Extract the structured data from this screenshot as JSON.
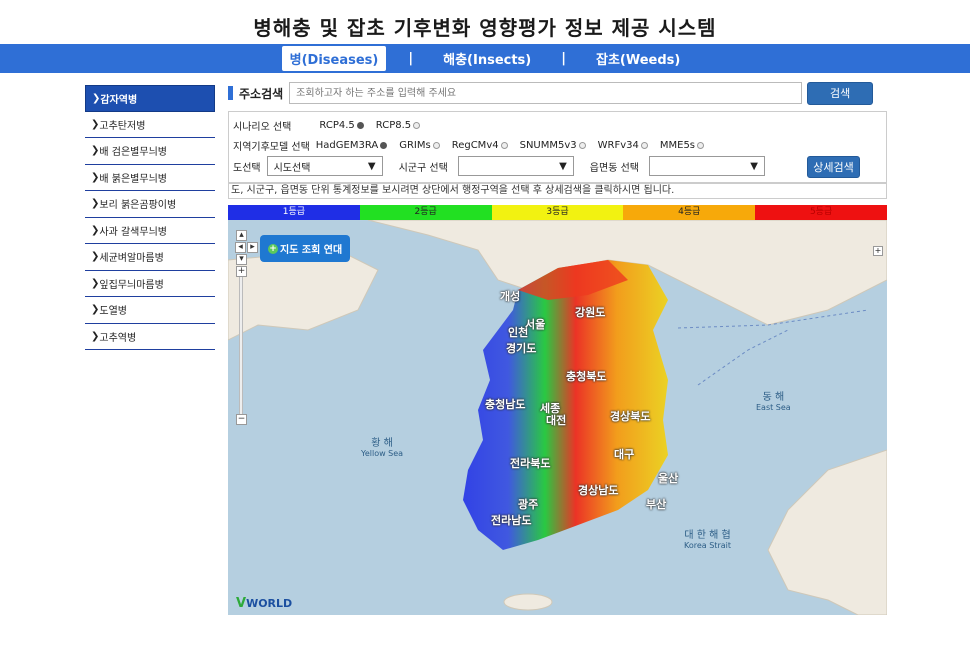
{
  "header": {
    "title": "병해충 및 잡초 기후변화 영향평가 정보 제공 시스템"
  },
  "nav": {
    "tabs": [
      {
        "label": "병(Diseases)",
        "active": true
      },
      {
        "label": "해충(Insects)",
        "active": false
      },
      {
        "label": "잡초(Weeds)",
        "active": false
      }
    ],
    "separator": "|"
  },
  "sidebar": {
    "items": [
      {
        "label": "감자역병",
        "active": true
      },
      {
        "label": "고추탄저병"
      },
      {
        "label": "배 검은별무늬병"
      },
      {
        "label": "배 붉은별무늬병"
      },
      {
        "label": "보리 붉은곰팡이병"
      },
      {
        "label": "사과 갈색무늬병"
      },
      {
        "label": "세균벼알마름병"
      },
      {
        "label": "잎집무늬마름병"
      },
      {
        "label": "도열병"
      },
      {
        "label": "고추역병"
      }
    ],
    "arrow": "❯"
  },
  "search": {
    "label": "주소검색",
    "placeholder": "조회하고자 하는 주소를 입력해 주세요",
    "button": "검색"
  },
  "options": {
    "scenario_label": "시나리오 선택",
    "scenarios": [
      {
        "label": "RCP4.5",
        "selected": true
      },
      {
        "label": "RCP8.5",
        "selected": false
      }
    ],
    "model_label": "지역기후모델 선택",
    "models": [
      {
        "label": "HadGEM3RA",
        "selected": true
      },
      {
        "label": "GRIMs",
        "selected": false
      },
      {
        "label": "RegCMv4",
        "selected": false
      },
      {
        "label": "SNUMM5v3",
        "selected": false
      },
      {
        "label": "WRFv34",
        "selected": false
      },
      {
        "label": "MME5s",
        "selected": false
      }
    ],
    "province_label": "도선택",
    "province_value": "시도선택",
    "city_label": "시군구 선택",
    "city_value": "",
    "town_label": "읍면동 선택",
    "town_value": "",
    "detail_button": "상세검색"
  },
  "notice": "도, 시군구, 읍면동 단위 통계정보를 보시려면 상단에서 행정구역을 선택 후 상세검색을 클릭하시면 됩니다.",
  "legend": [
    {
      "label": "1등급",
      "color": "#1f2ee6",
      "text": "#ffffff"
    },
    {
      "label": "2등급",
      "color": "#22e022",
      "text": "#1a1a1a"
    },
    {
      "label": "3등급",
      "color": "#f2f211",
      "text": "#1a1a1a"
    },
    {
      "label": "4등급",
      "color": "#f7a90a",
      "text": "#1a1a1a"
    },
    {
      "label": "5등급",
      "color": "#ee1111",
      "text": "#ee1111"
    }
  ],
  "map": {
    "toggle_button": "지도 조회 연대",
    "regions": [
      "개성",
      "인천",
      "서울",
      "강원도",
      "경기도",
      "충청북도",
      "충청남도",
      "세종",
      "대전",
      "경상북도",
      "전라북도",
      "대구",
      "울산",
      "경상남도",
      "광주",
      "부산",
      "전라남도"
    ],
    "seas": [
      {
        "ko": "동 해",
        "en": "East Sea"
      },
      {
        "ko": "황 해",
        "en": "Yellow Sea"
      },
      {
        "ko": "대 한 해 협",
        "en": "Korea Strait"
      }
    ],
    "brand": "WORLD",
    "brand_prefix": "V",
    "zoom_in": "+",
    "zoom_out": "−"
  }
}
